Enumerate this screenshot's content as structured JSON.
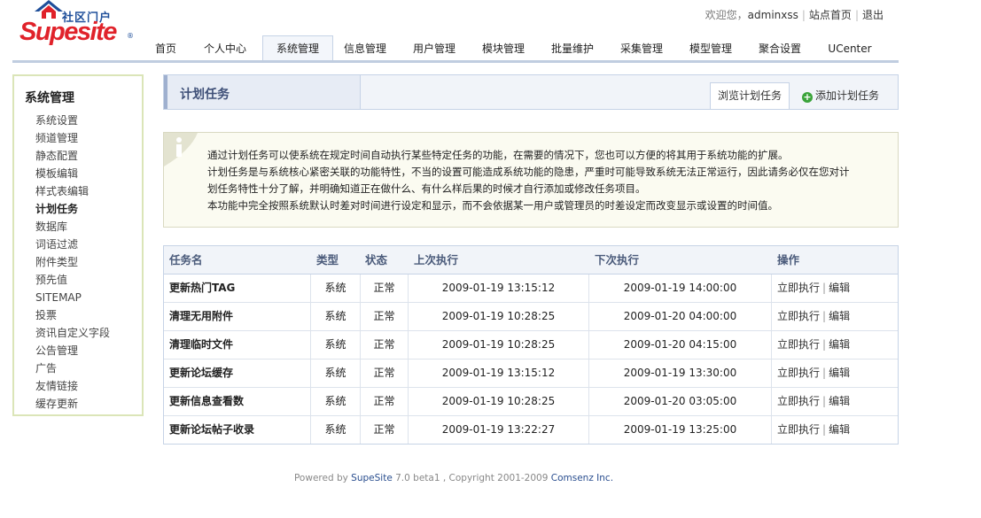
{
  "logo": {
    "cn_text": "社区门户",
    "en_text": "Supesite",
    "reg_mark": "®"
  },
  "toplinks": {
    "welcome": "欢迎您，",
    "username": "adminxss",
    "site_home": "站点首页",
    "logout": "退出"
  },
  "nav": {
    "tabs": [
      "首页",
      "个人中心",
      "系统管理",
      "信息管理",
      "用户管理",
      "模块管理",
      "批量维护",
      "采集管理",
      "模型管理",
      "聚合设置",
      "UCenter"
    ]
  },
  "sidebar": {
    "title": "系统管理",
    "items": [
      "系统设置",
      "频道管理",
      "静态配置",
      "模板编辑",
      "样式表编辑",
      "计划任务",
      "数据库",
      "词语过滤",
      "附件类型",
      "预先值",
      "SITEMAP",
      "投票",
      "资讯自定义字段",
      "公告管理",
      "广告",
      "友情链接",
      "缓存更新"
    ]
  },
  "panel": {
    "title": "计划任务",
    "tab_browse": "浏览计划任务",
    "tab_add": "添加计划任务"
  },
  "info": {
    "lines": [
      "通过计划任务可以使系统在规定时间自动执行某些特定任务的功能，在需要的情况下，您也可以方便的将其用于系统功能的扩展。",
      "计划任务是与系统核心紧密关联的功能特性，不当的设置可能造成系统功能的隐患，严重时可能导致系统无法正常运行，因此请务必仅在您对计",
      "划任务特性十分了解，并明确知道正在做什么、有什么样后果的时候才自行添加或修改任务项目。",
      "本功能中完全按照系统默认时差对时间进行设定和显示，而不会依据某一用户或管理员的时差设定而改变显示或设置的时间值。"
    ]
  },
  "table": {
    "headers": [
      "任务名",
      "类型",
      "状态",
      "上次执行",
      "下次执行",
      "操作"
    ],
    "rows": [
      {
        "name": "更新热门TAG",
        "type": "系统",
        "status": "正常",
        "last": "2009-01-19 13:15:12",
        "next": "2009-01-19 14:00:00"
      },
      {
        "name": "清理无用附件",
        "type": "系统",
        "status": "正常",
        "last": "2009-01-19 10:28:25",
        "next": "2009-01-20 04:00:00"
      },
      {
        "name": "清理临时文件",
        "type": "系统",
        "status": "正常",
        "last": "2009-01-19 10:28:25",
        "next": "2009-01-20 04:15:00"
      },
      {
        "name": "更新论坛缓存",
        "type": "系统",
        "status": "正常",
        "last": "2009-01-19 13:15:12",
        "next": "2009-01-19 13:30:00"
      },
      {
        "name": "更新信息查看数",
        "type": "系统",
        "status": "正常",
        "last": "2009-01-19 10:28:25",
        "next": "2009-01-20 03:05:00"
      },
      {
        "name": "更新论坛帖子收录",
        "type": "系统",
        "status": "正常",
        "last": "2009-01-19 13:22:27",
        "next": "2009-01-19 13:25:00"
      }
    ],
    "action_run": "立即执行",
    "action_edit": "编辑"
  },
  "footer": {
    "prefix": "Powered by ",
    "brand": "SupeSite",
    "version": " 7.0 beta1 , Copyright 2001-2009 ",
    "company": "Comsenz Inc."
  }
}
